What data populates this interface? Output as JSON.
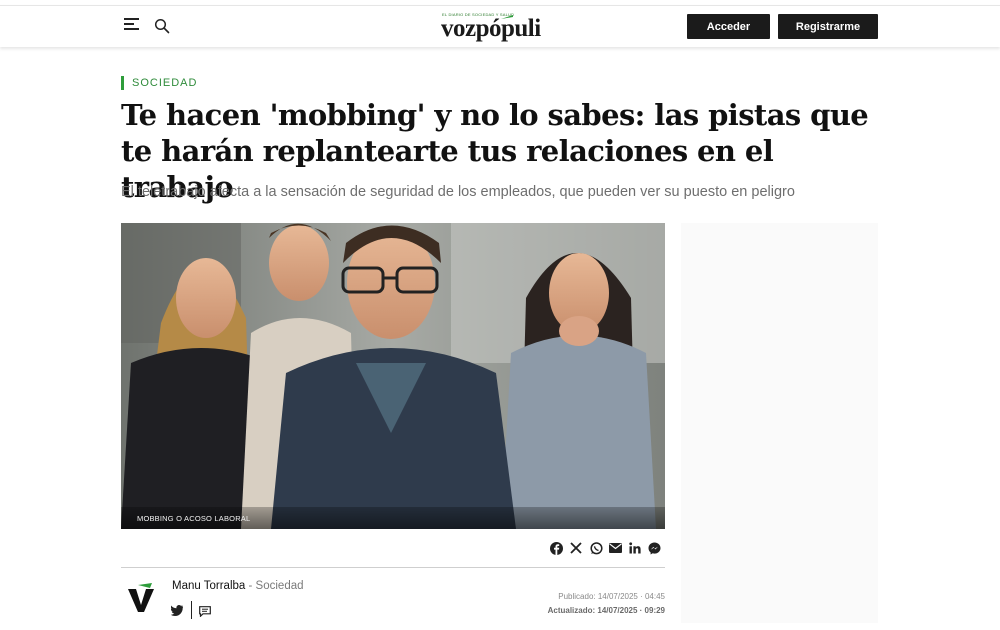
{
  "header": {
    "logo": {
      "tagline": "EL DIARIO DE SOCIEDAD Y SALUD",
      "wordmark": "vozpópuli"
    },
    "login_label": "Acceder",
    "register_label": "Registrarme",
    "icons": [
      "menu-icon",
      "search-icon"
    ]
  },
  "article": {
    "section": "SOCIEDAD",
    "headline": "Te hacen 'mobbing' y no lo sabes: las pistas que te harán replantearte tus relaciones en el trabajo",
    "subtitle": "El teletrabajo afecta a la sensación de seguridad de los empleados, que pueden ver su puesto en peligro",
    "image_caption": "MOBBING O ACOSO LABORAL",
    "share_icons": [
      "facebook-icon",
      "x-icon",
      "whatsapp-icon",
      "email-icon",
      "linkedin-icon",
      "messenger-icon"
    ],
    "author": {
      "name": "Manu Torralba",
      "separator": " - ",
      "category": "Sociedad"
    },
    "published": "Publicado: 14/07/2025 · 04:45",
    "updated": "Actualizado: 14/07/2025 · 09:29"
  },
  "colors": {
    "accent_green": "#2e9d3b",
    "button_bg": "#1b1b1b"
  }
}
